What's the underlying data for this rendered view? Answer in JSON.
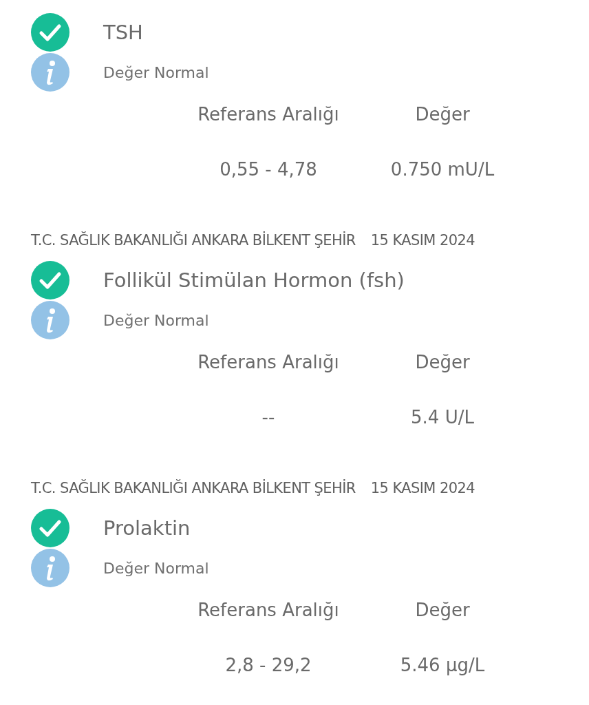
{
  "results": [
    {
      "test": "TSH",
      "status": "Değer Normal",
      "range_label": "Referans Aralığı",
      "value_label": "Değer",
      "range": "0,55 - 4,78",
      "value": "0.750 mU/L"
    },
    {
      "source": "T.C. SAĞLIK BAKANLIĞI ANKARA BİLKENT ŞEHİR",
      "date": "15 KASIM 2024",
      "test": "Follikül Stimülan Hormon (fsh)",
      "status": "Değer Normal",
      "range_label": "Referans Aralığı",
      "value_label": "Değer",
      "range": "--",
      "value": "5.4 U/L"
    },
    {
      "source": "T.C. SAĞLIK BAKANLIĞI ANKARA BİLKENT ŞEHİR",
      "date": "15 KASIM 2024",
      "test": "Prolaktin",
      "status": "Değer Normal",
      "range_label": "Referans Aralığı",
      "value_label": "Değer",
      "range": "2,8 - 29,2",
      "value": "5.46 µg/L"
    }
  ]
}
